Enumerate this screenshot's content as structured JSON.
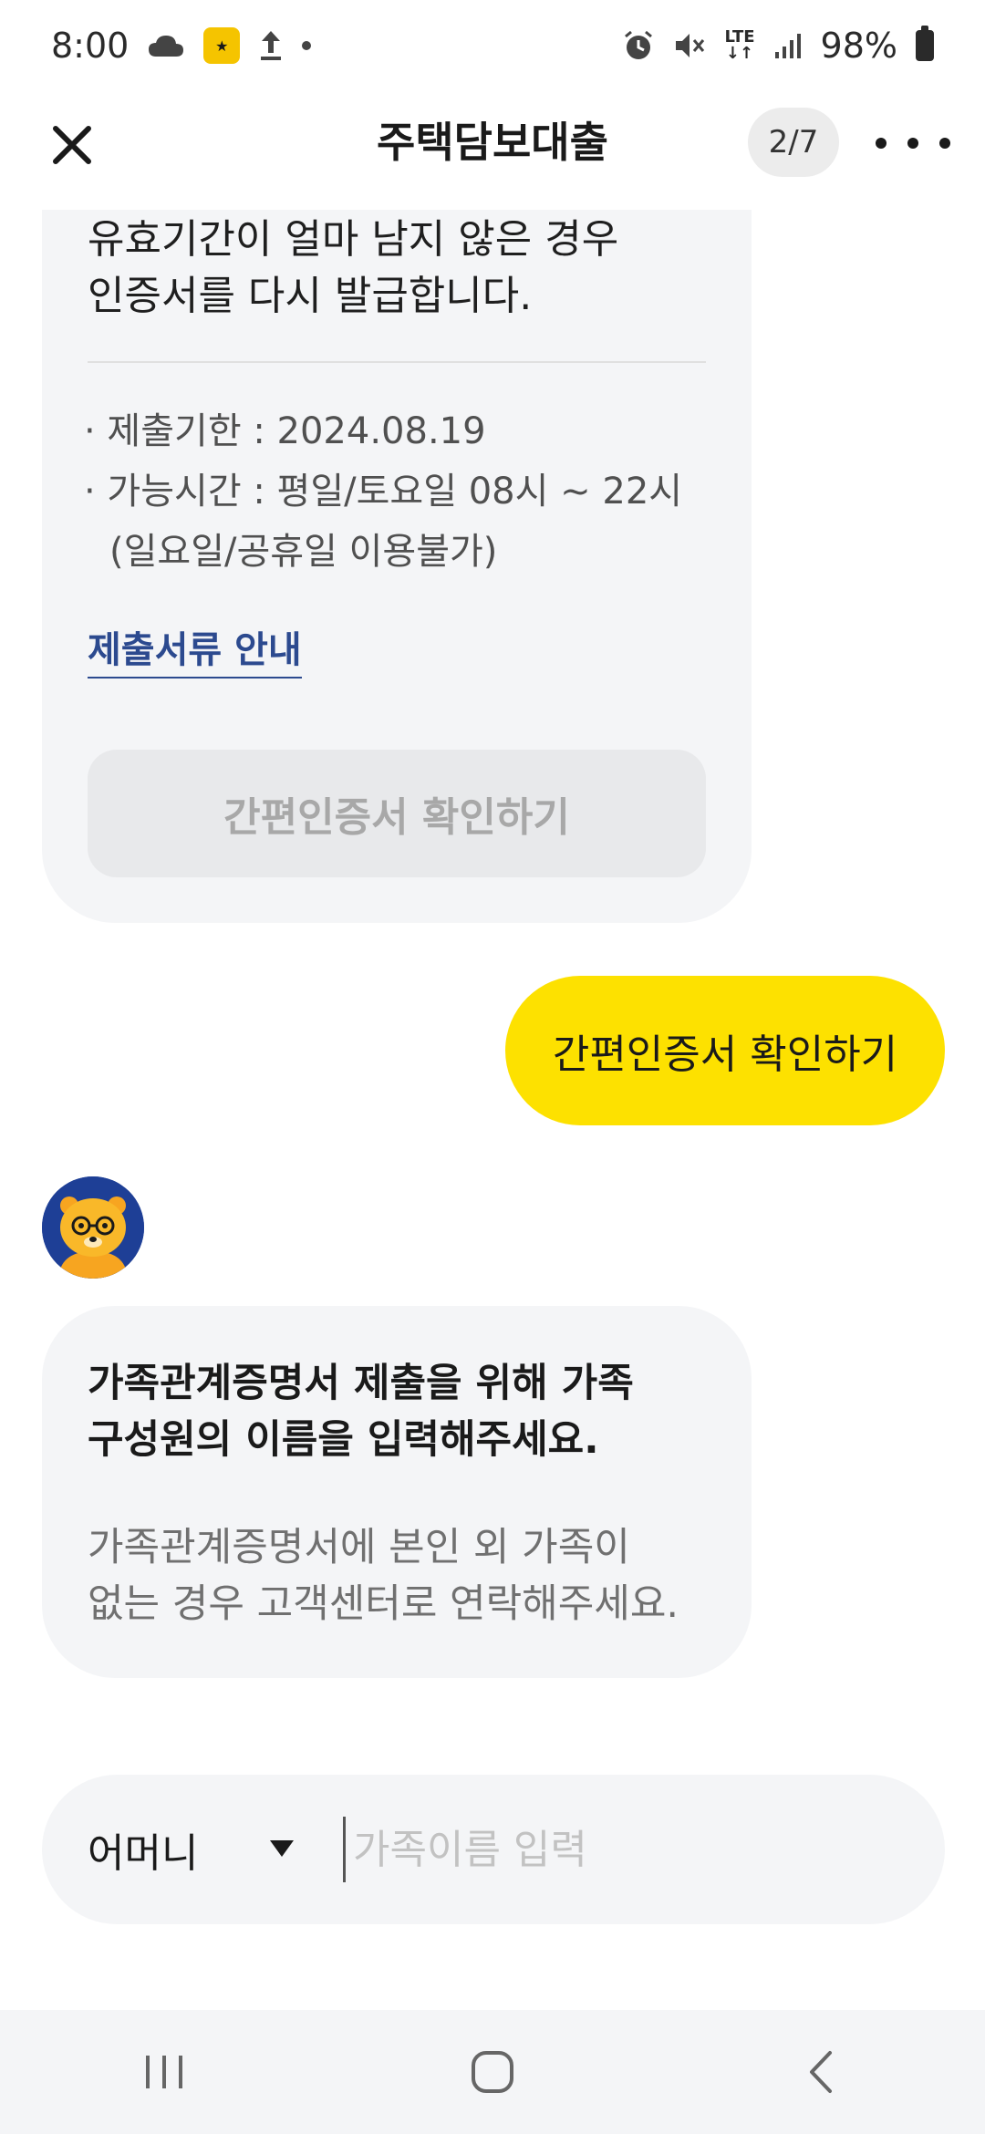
{
  "status_bar": {
    "time": "8:00",
    "network": "LTE",
    "battery": "98%",
    "left_icons": [
      "cloud-icon",
      "app-notification-icon",
      "upload-icon",
      "dot-icon"
    ],
    "right_icons": [
      "alarm-icon",
      "mute-icon",
      "lte-icon",
      "signal-icon",
      "battery-icon"
    ]
  },
  "header": {
    "title": "주택담보대출",
    "page_indicator": "2/7",
    "close_icon": "close-icon",
    "more_icon": "more-icon"
  },
  "chat": {
    "top_bubble": {
      "text_line1": "유효기간이 얼마 남지 않은 경우",
      "text_line2": "인증서를 다시 발급합니다.",
      "deadline": "· 제출기한 : 2024.08.19",
      "hours": "· 가능시간 : 평일/토요일 08시 ~ 22시",
      "hours_note": "(일요일/공휴일 이용불가)",
      "docs_link": "제출서류 안내",
      "confirm_button": "간편인증서 확인하기"
    },
    "user_message": "간편인증서 확인하기",
    "bot_message": {
      "title_line1": "가족관계증명서 제출을 위해 가족",
      "title_line2": "구성원의 이름을 입력해주세요.",
      "desc_line1": "가족관계증명서에 본인 외 가족이",
      "desc_line2": "없는 경우 고객센터로 연락해주세요."
    }
  },
  "input_bar": {
    "relation_value": "어머니",
    "name_placeholder": "가족이름 입력",
    "name_value": ""
  },
  "colors": {
    "accent_yellow": "#fde100",
    "bubble_bg": "#f4f5f7",
    "link_blue": "#2c4a8f",
    "avatar_bg": "#1e3f96"
  }
}
